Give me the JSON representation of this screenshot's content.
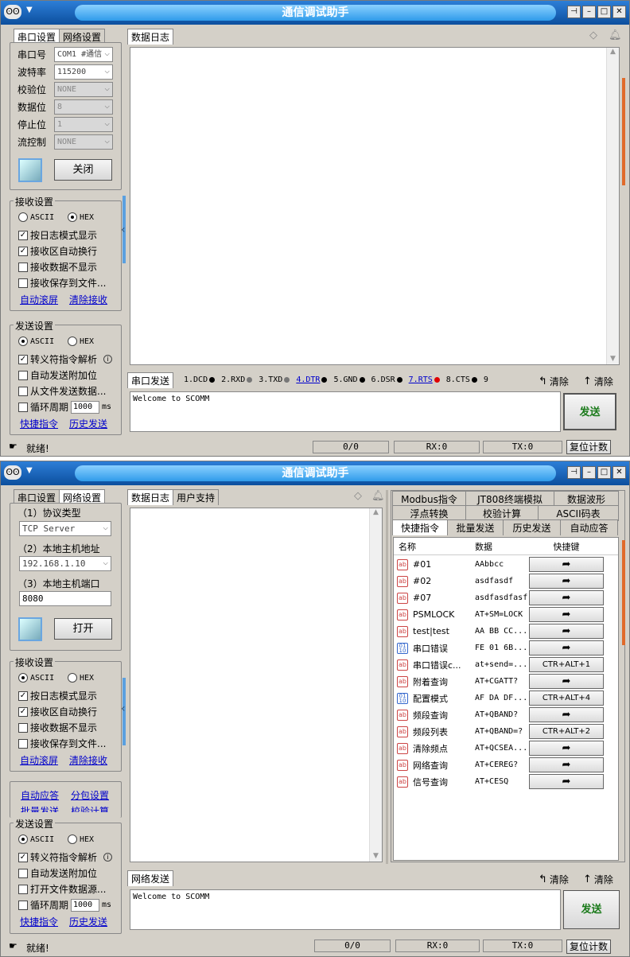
{
  "app_title": "通信调试助手",
  "owl_icon": "owl-icon",
  "win1": {
    "left_tabs": [
      "串口设置",
      "网络设置"
    ],
    "port_rows": [
      {
        "label": "串口号",
        "value": "COM1 #通信",
        "disabled": false
      },
      {
        "label": "波特率",
        "value": "115200",
        "disabled": false
      },
      {
        "label": "校验位",
        "value": "NONE",
        "disabled": true
      },
      {
        "label": "数据位",
        "value": "8",
        "disabled": true
      },
      {
        "label": "停止位",
        "value": "1",
        "disabled": true
      },
      {
        "label": "流控制",
        "value": "NONE",
        "disabled": true
      }
    ],
    "close_button": "关闭",
    "recv": {
      "title": "接收设置",
      "ascii": "ASCII",
      "hex": "HEX",
      "opt1": "按日志模式显示",
      "opt2": "接收区自动换行",
      "opt3": "接收数据不显示",
      "opt4": "接收保存到文件...",
      "link1": "自动滚屏",
      "link2": "清除接收"
    },
    "send": {
      "title": "发送设置",
      "ascii": "ASCII",
      "hex": "HEX",
      "opt1": "转义符指令解析",
      "opt2": "自动发送附加位",
      "opt3": "从文件发送数据...",
      "opt4": "循环周期",
      "period": "1000",
      "unit": "ms",
      "link1": "快捷指令",
      "link2": "历史发送"
    },
    "log_tab": "数据日志",
    "send_tab": "串口发送",
    "pins": [
      {
        "label": "1.DCD",
        "link": false,
        "color": "#000000"
      },
      {
        "label": "2.RXD",
        "link": false,
        "color": "#777777"
      },
      {
        "label": "3.TXD",
        "link": false,
        "color": "#777777"
      },
      {
        "label": "4.DTR",
        "link": true,
        "color": "#000000"
      },
      {
        "label": "5.GND",
        "link": false,
        "color": "#000000"
      },
      {
        "label": "6.DSR",
        "link": false,
        "color": "#000000"
      },
      {
        "label": "7.RTS",
        "link": true,
        "color": "#e00000"
      },
      {
        "label": "8.CTS",
        "link": false,
        "color": "#000000"
      },
      {
        "label": "9",
        "link": false,
        "color": "#000000"
      }
    ],
    "clear1": "清除",
    "clear2": "清除",
    "send_text": "Welcome to SCOMM",
    "send_button": "发送",
    "status_ready": "就绪!",
    "count": "0/0",
    "rx": "RX:0",
    "tx": "TX:0",
    "reset": "复位计数"
  },
  "win2": {
    "left_tabs": [
      "串口设置",
      "网络设置"
    ],
    "proto_label": "（1）协议类型",
    "proto_value": "TCP Server",
    "host_label": "（2）本地主机地址",
    "host_value": "192.168.1.10",
    "port_label": "（3）本地主机端口",
    "port_value": "8080",
    "open_button": "打开",
    "recv": {
      "title": "接收设置",
      "ascii": "ASCII",
      "hex": "HEX",
      "opt1": "按日志模式显示",
      "opt2": "接收区自动换行",
      "opt3": "接收数据不显示",
      "opt4": "接收保存到文件...",
      "link1": "自动滚屏",
      "link2": "清除接收"
    },
    "extra_links": [
      "自动应答",
      "分包设置",
      "批量发送",
      "校验计算"
    ],
    "send": {
      "title": "发送设置",
      "ascii": "ASCII",
      "hex": "HEX",
      "opt1": "转义符指令解析",
      "opt2": "自动发送附加位",
      "opt3": "打开文件数据源...",
      "opt4": "循环周期",
      "period": "1000",
      "unit": "ms",
      "link1": "快捷指令",
      "link2": "历史发送"
    },
    "log_tabs": [
      "数据日志",
      "用户支持"
    ],
    "right_tabs_row1": [
      "Modbus指令",
      "JT808终端模拟",
      "数据波形"
    ],
    "right_tabs_row2": [
      "浮点转换",
      "校验计算",
      "ASCII码表"
    ],
    "right_tabs_row3": [
      "快捷指令",
      "批量发送",
      "历史发送",
      "自动应答"
    ],
    "table_headers": [
      "名称",
      "数据",
      "快捷键"
    ],
    "commands": [
      {
        "icon": "ab",
        "name": "#01",
        "data": "AAbbcc",
        "key": ""
      },
      {
        "icon": "ab",
        "name": "#02",
        "data": "asdfasdf",
        "key": ""
      },
      {
        "icon": "ab",
        "name": "#07",
        "data": "asdfasdfasf",
        "key": ""
      },
      {
        "icon": "ab",
        "name": "PSMLOCK",
        "data": "AT+SM=LOCK",
        "key": ""
      },
      {
        "icon": "ab",
        "name": "test|test",
        "data": "AA BB CC...",
        "key": ""
      },
      {
        "icon": "hex",
        "name": "串口错误",
        "data": "FE 01 6B...",
        "key": ""
      },
      {
        "icon": "ab",
        "name": "串口错误c...",
        "data": "at+send=...",
        "key": "CTR+ALT+1"
      },
      {
        "icon": "ab",
        "name": "附着查询",
        "data": "AT+CGATT?",
        "key": ""
      },
      {
        "icon": "hex",
        "name": "配置模式",
        "data": "AF DA DF...",
        "key": "CTR+ALT+4"
      },
      {
        "icon": "ab",
        "name": "频段查询",
        "data": "AT+QBAND?",
        "key": ""
      },
      {
        "icon": "ab",
        "name": "频段列表",
        "data": "AT+QBAND=?",
        "key": "CTR+ALT+2"
      },
      {
        "icon": "ab",
        "name": "清除频点",
        "data": "AT+QCSEA...",
        "key": ""
      },
      {
        "icon": "ab",
        "name": "网络查询",
        "data": "AT+CEREG?",
        "key": ""
      },
      {
        "icon": "ab",
        "name": "信号查询",
        "data": "AT+CESQ",
        "key": ""
      }
    ],
    "send_tab": "网络发送",
    "clear1": "清除",
    "clear2": "清除",
    "send_text": "Welcome to SCOMM",
    "send_button": "发送",
    "status_ready": "就绪!",
    "count": "0/0",
    "rx": "RX:0",
    "tx": "TX:0",
    "reset": "复位计数"
  }
}
